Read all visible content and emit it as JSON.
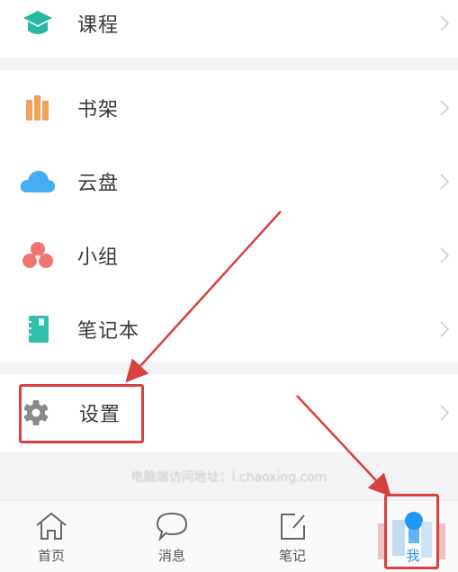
{
  "menu": {
    "top_item": {
      "label": "课程",
      "icon": "graduation-cap-icon",
      "color": "#26b8a0"
    },
    "items": [
      {
        "label": "书架",
        "icon": "bookshelf-icon",
        "color": "#f0a15a"
      },
      {
        "label": "云盘",
        "icon": "cloud-icon",
        "color": "#45aef2"
      },
      {
        "label": "小组",
        "icon": "group-icon",
        "color": "#f07470"
      },
      {
        "label": "笔记本",
        "icon": "notebook-icon",
        "color": "#2ec0a8"
      }
    ],
    "settings": {
      "label": "设置",
      "icon": "gear-icon",
      "color": "#8a8a8a"
    }
  },
  "footer_note": "电脑端访问地址：i.chaoxing.com",
  "tabbar": {
    "tabs": [
      {
        "label": "首页",
        "icon": "home-icon"
      },
      {
        "label": "消息",
        "icon": "message-icon"
      },
      {
        "label": "笔记",
        "icon": "note-edit-icon"
      },
      {
        "label": "我",
        "icon": "user-icon",
        "active": true
      }
    ],
    "active_color": "#2196f3"
  },
  "annotations": {
    "color": "#d94040"
  }
}
